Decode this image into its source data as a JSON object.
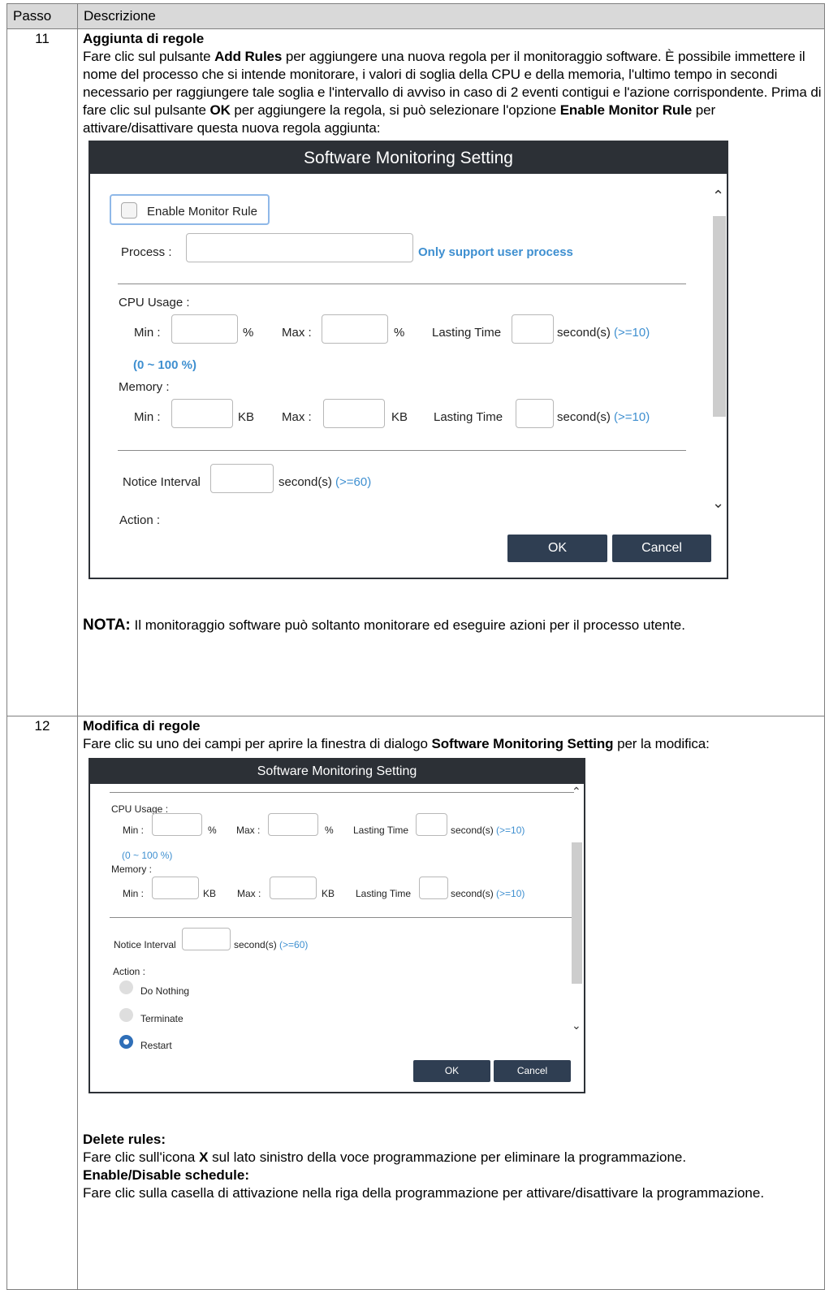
{
  "table": {
    "header": {
      "step": "Passo",
      "description": "Descrizione"
    },
    "rows": [
      {
        "step": "11",
        "heading": "Aggiunta di regole",
        "p1_a": "Fare clic sul pulsante ",
        "p1_b": "Add Rules",
        "p1_c": " per aggiungere una nuova regola per il monitoraggio software. È possibile immettere il nome del processo che si intende monitorare, i valori di soglia della CPU e della memoria, l'ultimo tempo in secondi necessario per raggiungere tale soglia e l'intervallo di avviso in caso di 2 eventi contigui e l'azione corrispondente. Prima di fare clic sul pulsante ",
        "p1_d": "OK",
        "p1_e": " per aggiungere la regola, si può selezionare l'opzione ",
        "p1_f": "Enable Monitor Rule",
        "p1_g": " per attivare/disattivare questa nuova regola aggiunta:",
        "note_label": "NOTA:",
        "note_text": " Il monitoraggio software può soltanto monitorare ed eseguire azioni per il processo utente."
      },
      {
        "step": "12",
        "heading": "Modifica di regole",
        "p1_a": "Fare clic su uno dei campi per aprire la finestra di dialogo ",
        "p1_b": "Software Monitoring Setting",
        "p1_c": " per la modifica:",
        "delete_heading": "Delete rules:",
        "delete_a": "Fare clic sull'icona ",
        "delete_b": "X",
        "delete_c": " sul lato sinistro della voce programmazione per eliminare la programmazione.",
        "enable_heading": "Enable/Disable schedule:",
        "enable_text": "Fare clic sulla casella di attivazione nella riga della programmazione per attivare/disattivare la programmazione."
      }
    ]
  },
  "dialog1": {
    "title": "Software Monitoring Setting",
    "enable_rule": "Enable Monitor Rule",
    "process_label": "Process :",
    "process_hint": "Only support user process",
    "cpu_usage": "CPU Usage :",
    "min": "Min :",
    "max": "Max :",
    "percent": "%",
    "lasting_time": "Lasting Time",
    "seconds": "second(s)",
    "ge10": "(>=10)",
    "range": "(0 ~ 100 %)",
    "memory": "Memory :",
    "kb": "KB",
    "notice_interval": "Notice Interval",
    "ge60": "(>=60)",
    "action": "Action :",
    "ok": "OK",
    "cancel": "Cancel"
  },
  "dialog2": {
    "title": "Software Monitoring Setting",
    "cpu_usage": "CPU Usage :",
    "min": "Min :",
    "max": "Max :",
    "percent": "%",
    "lasting_time": "Lasting Time",
    "seconds": "second(s)",
    "ge10": "(>=10)",
    "range": "(0 ~ 100 %)",
    "memory": "Memory :",
    "kb": "KB",
    "notice_interval": "Notice Interval",
    "ge60": "(>=60)",
    "action": "Action :",
    "actions": [
      "Do Nothing",
      "Terminate",
      "Restart"
    ],
    "selected_action": "Restart",
    "ok": "OK",
    "cancel": "Cancel"
  }
}
